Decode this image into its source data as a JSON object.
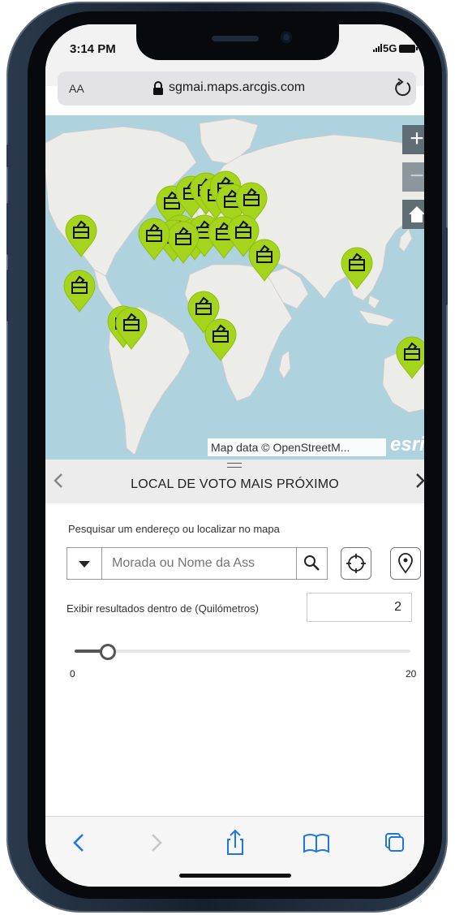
{
  "status_bar": {
    "time": "3:14 PM",
    "network": "5G"
  },
  "browser": {
    "text_size_label": "AA",
    "url": "sgmai.maps.arcgis.com"
  },
  "map": {
    "attribution": "Map data © OpenStreetM...",
    "brand": "esri",
    "zoom_in_label": "+",
    "zoom_out_label": "−",
    "marker_color": "#a4d51c"
  },
  "panel": {
    "title": "LOCAL DE VOTO MAIS PRÓXIMO",
    "search_label": "Pesquisar um endereço ou localizar no mapa",
    "search_placeholder": "Morada ou Nome da Ass",
    "radius_label": "Exibir resultados dentro de (Quilómetros)",
    "radius_value": "2",
    "slider_min": "0",
    "slider_max": "20",
    "slider_value_fraction": 0.1
  },
  "toolbar": {
    "items": [
      "back-icon",
      "forward-icon",
      "share-icon",
      "bookmarks-icon",
      "tabs-icon"
    ]
  }
}
